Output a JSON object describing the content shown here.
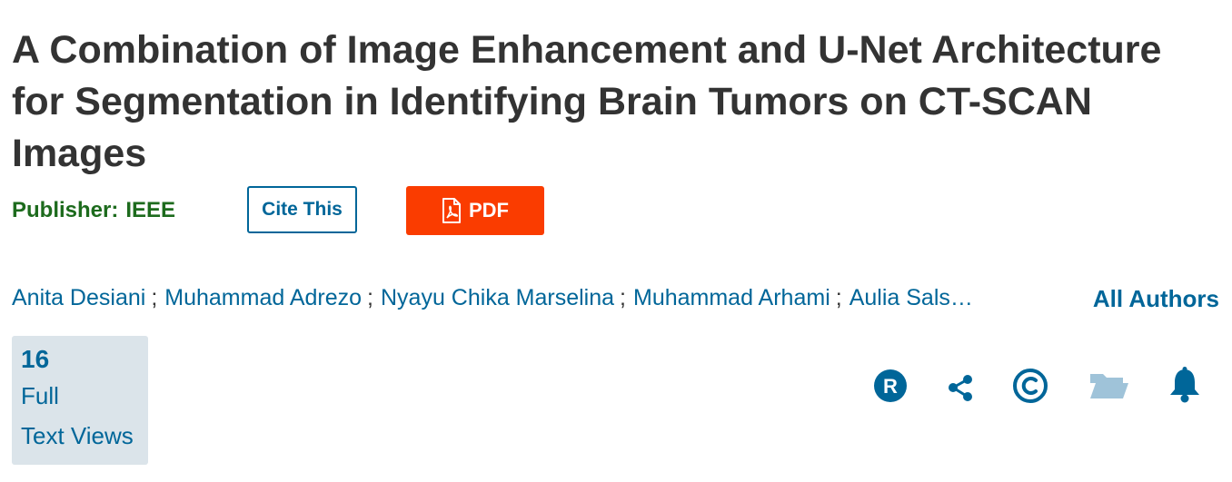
{
  "article": {
    "title": "A Combination of Image Enhancement and U-Net Architecture for Segmentation in Identifying Brain Tumors on CT-SCAN Images",
    "publisher_label": "Publisher:",
    "publisher_name": "IEEE"
  },
  "actions": {
    "cite_label": "Cite This",
    "pdf_label": "PDF"
  },
  "authors": {
    "names": [
      "Anita Desiani",
      "Muhammad Adrezo",
      "Nyayu Chika Marselina",
      "Muhammad Arhami",
      "Aulia Sals…"
    ],
    "separator": ";",
    "all_authors_label": "All Authors"
  },
  "metrics": {
    "count": "16",
    "label_line1": "Full",
    "label_line2": "Text Views"
  },
  "tools": {
    "icons": [
      "rights-permissions-icon",
      "share-icon",
      "copyright-icon",
      "folder-icon",
      "alert-bell-icon"
    ],
    "colors": {
      "active": "#006699",
      "inactive": "#9fc3d9"
    }
  },
  "colors": {
    "title": "#333333",
    "publisher": "#1d6b1d",
    "link": "#006699",
    "pdf_button": "#fa3c00",
    "metrics_bg": "#dbe4ea"
  }
}
